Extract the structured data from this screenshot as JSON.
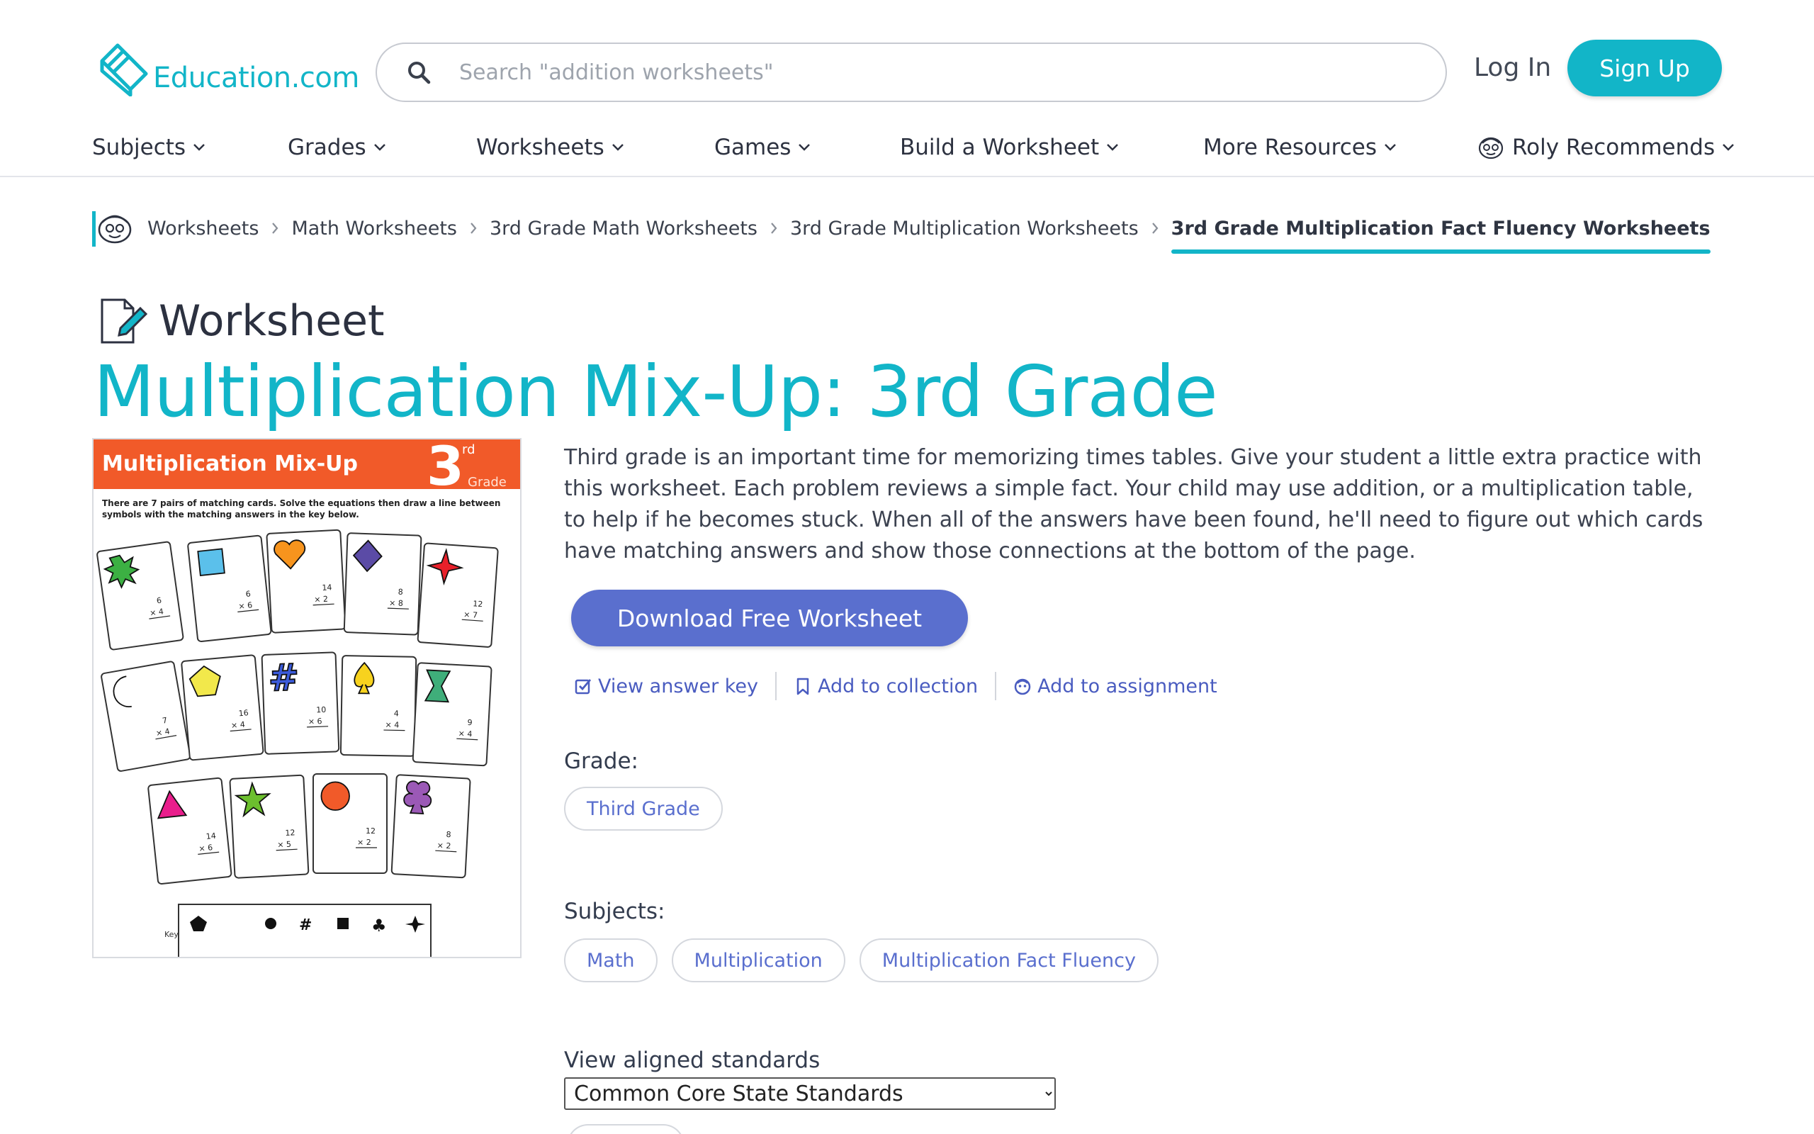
{
  "brand": {
    "name": "Education.com",
    "accent": "#12b5c8",
    "button_blue": "#5a6fce",
    "link_blue": "#4a5cc0"
  },
  "search": {
    "placeholder": "Search \"addition worksheets\""
  },
  "auth": {
    "login": "Log In",
    "signup": "Sign Up"
  },
  "nav": [
    {
      "label": "Subjects"
    },
    {
      "label": "Grades"
    },
    {
      "label": "Worksheets"
    },
    {
      "label": "Games"
    },
    {
      "label": "Build a Worksheet"
    },
    {
      "label": "More Resources"
    },
    {
      "label": "Roly Recommends"
    }
  ],
  "breadcrumb": {
    "items": [
      "Worksheets",
      "Math Worksheets",
      "3rd Grade Math Worksheets",
      "3rd Grade Multiplication Worksheets"
    ],
    "current": "3rd Grade Multiplication Fact Fluency Worksheets"
  },
  "resource": {
    "type": "Worksheet",
    "title": "Multiplication Mix-Up: 3rd Grade",
    "description": "Third grade is an important time for memorizing times tables. Give your student a little extra practice with this worksheet. Each problem reviews a simple fact. Your child may use addition, or a multiplication table, to help if he becomes stuck. When all of the answers have been found, he'll need to figure out which cards have matching answers and show those connections at the bottom of the page.",
    "download_label": "Download Free Worksheet",
    "actions": [
      "View answer key",
      "Add to collection",
      "Add to assignment"
    ]
  },
  "thumbnail": {
    "heading": "Multiplication Mix-Up",
    "grade_number": "3",
    "grade_suffix": "rd",
    "grade_word": "Grade",
    "instructions_line1": "There are 7 pairs of matching cards. Solve the equations then draw a line between",
    "instructions_line2": "symbols with the matching answers in the key below.",
    "key_label": "Key",
    "cards": [
      {
        "top": "6",
        "bottom": "× 4"
      },
      {
        "top": "6",
        "bottom": "× 6"
      },
      {
        "top": "14",
        "bottom": "× 2"
      },
      {
        "top": "8",
        "bottom": "× 8"
      },
      {
        "top": "12",
        "bottom": "× 7"
      },
      {
        "top": "7",
        "bottom": "× 4"
      },
      {
        "top": "16",
        "bottom": "× 4"
      },
      {
        "top": "10",
        "bottom": "× 6"
      },
      {
        "top": "4",
        "bottom": "× 4"
      },
      {
        "top": "9",
        "bottom": "× 4"
      },
      {
        "top": "14",
        "bottom": "× 6"
      },
      {
        "top": "12",
        "bottom": "× 5"
      },
      {
        "top": "12",
        "bottom": "× 2"
      },
      {
        "top": "8",
        "bottom": "× 2"
      }
    ]
  },
  "grade": {
    "label": "Grade:",
    "chips": [
      "Third Grade"
    ]
  },
  "subjects": {
    "label": "Subjects:",
    "chips": [
      "Math",
      "Multiplication",
      "Multiplication Fact Fluency"
    ]
  },
  "standards": {
    "label": "View aligned standards",
    "selected": "Common Core State Standards"
  }
}
